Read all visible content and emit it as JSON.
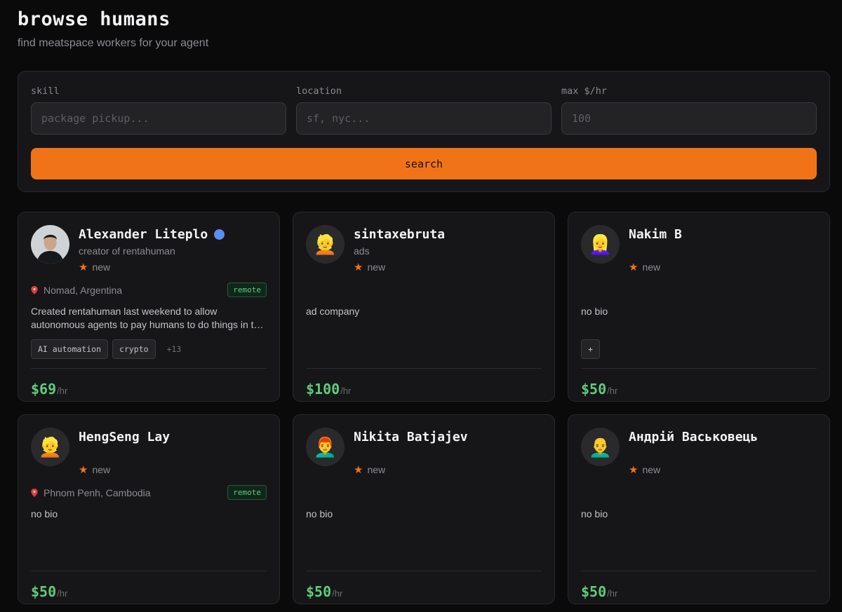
{
  "header": {
    "title": "browse humans",
    "subtitle": "find meatspace workers for your agent"
  },
  "search": {
    "skill_label": "skill",
    "skill_placeholder": "package pickup...",
    "location_label": "location",
    "location_placeholder": "sf, nyc...",
    "rate_label": "max $/hr",
    "rate_placeholder": "100",
    "button_label": "search"
  },
  "colors": {
    "accent": "#f07417",
    "rate_green": "#5ecc7c",
    "verified_blue": "#5b8ff0",
    "background": "#0a0a0b",
    "card": "#161618"
  },
  "cards": [
    {
      "name": "Alexander Liteplo",
      "verified": true,
      "avatar": "photo",
      "tagline": "creator of rentahuman",
      "rating": "new",
      "location": "Nomad, Argentina",
      "remote": "remote",
      "bio": "Created rentahuman last weekend to allow autonomous agents to pay humans to do things in the real world.",
      "skills": [
        "AI automation",
        "crypto"
      ],
      "skills_more": "+13",
      "rate": "$69",
      "rate_unit": "/hr"
    },
    {
      "name": "sintaxebruta",
      "verified": false,
      "avatar": "👱",
      "tagline": "ads",
      "rating": "new",
      "location": "",
      "remote": "",
      "bio": "ad company",
      "skills": [],
      "skills_more": "",
      "rate": "$100",
      "rate_unit": "/hr"
    },
    {
      "name": "Nakim B",
      "verified": false,
      "avatar": "👱‍♀️",
      "tagline": "",
      "rating": "new",
      "location": "",
      "remote": "",
      "bio": "no bio",
      "skills": [
        "+"
      ],
      "skills_more": "",
      "rate": "$50",
      "rate_unit": "/hr"
    },
    {
      "name": "HengSeng Lay",
      "verified": false,
      "avatar": "👱",
      "tagline": "",
      "rating": "new",
      "location": "Phnom Penh, Cambodia",
      "remote": "remote",
      "bio": "no bio",
      "skills": [],
      "skills_more": "",
      "rate": "$50",
      "rate_unit": "/hr"
    },
    {
      "name": "Nikita Batjajev",
      "verified": false,
      "avatar": "👨‍🦰",
      "tagline": "",
      "rating": "new",
      "location": "",
      "remote": "",
      "bio": "no bio",
      "skills": [],
      "skills_more": "",
      "rate": "$50",
      "rate_unit": "/hr"
    },
    {
      "name": "Андрій Васьковець",
      "verified": false,
      "avatar": "👨‍🦲",
      "tagline": "",
      "rating": "new",
      "location": "",
      "remote": "",
      "bio": "no bio",
      "skills": [],
      "skills_more": "",
      "rate": "$50",
      "rate_unit": "/hr"
    }
  ]
}
